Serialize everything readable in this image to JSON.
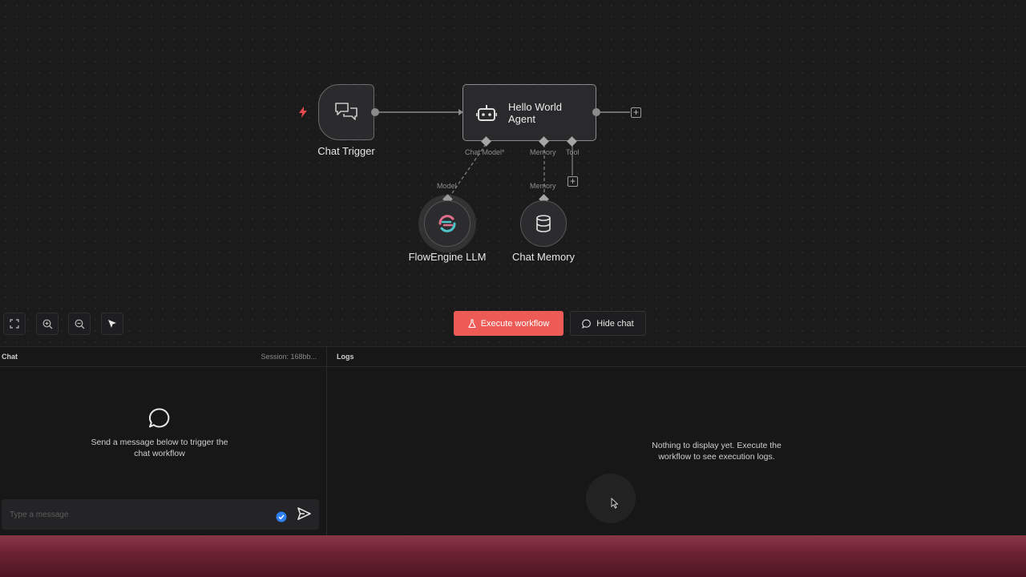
{
  "canvas": {
    "nodes": {
      "trigger": {
        "label": "Chat Trigger",
        "icon": "chat-bubbles-icon"
      },
      "agent": {
        "title": "Hello World Agent",
        "icon": "robot-icon"
      },
      "llm": {
        "label": "FlowEngine LLM",
        "icon": "flowengine-logo-icon"
      },
      "memory": {
        "label": "Chat Memory",
        "icon": "database-icon"
      }
    },
    "ports": {
      "chat_model": "Chat Model*",
      "memory": "Memory",
      "tool": "Tool",
      "model_in": "Model",
      "memory_in": "Memory"
    },
    "toolbar": [
      "fit-view-icon",
      "zoom-in-icon",
      "zoom-out-icon",
      "cursor-icon"
    ],
    "execute_label": "Execute workflow",
    "hide_chat_label": "Hide chat"
  },
  "chat": {
    "title": "Chat",
    "session": "Session: 168bb...",
    "empty_text": "Send a message below to trigger the chat workflow",
    "input_placeholder": "Type a message"
  },
  "logs": {
    "title": "Logs",
    "empty_text": "Nothing to display yet. Execute the workflow to see execution logs."
  },
  "colors": {
    "accent": "#ec5b56",
    "background": "#1b1b1c",
    "footer": "#7a2a3b"
  }
}
